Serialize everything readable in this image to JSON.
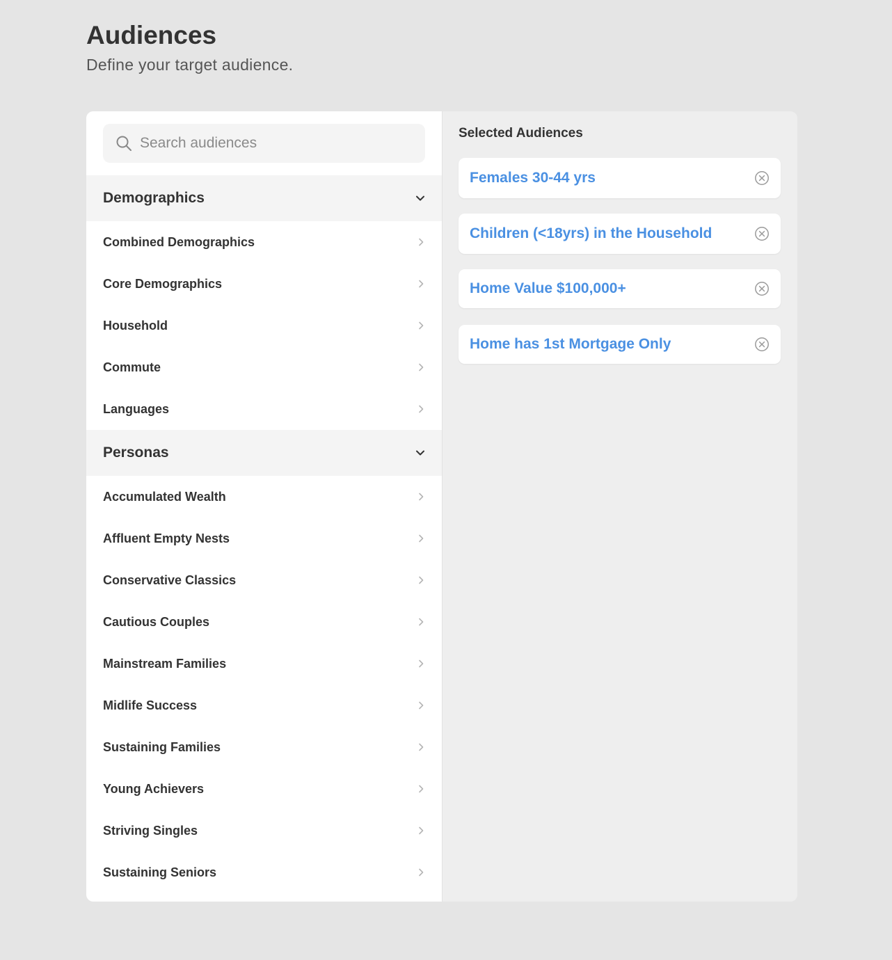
{
  "header": {
    "title": "Audiences",
    "subtitle": "Define your target audience."
  },
  "search": {
    "placeholder": "Search audiences",
    "value": ""
  },
  "groups": [
    {
      "title": "Demographics",
      "expanded": true,
      "items": [
        "Combined Demographics",
        "Core Demographics",
        "Household",
        "Commute",
        "Languages"
      ]
    },
    {
      "title": "Personas",
      "expanded": true,
      "items": [
        "Accumulated Wealth",
        "Affluent Empty Nests",
        "Conservative Classics",
        "Cautious Couples",
        "Mainstream Families",
        "Midlife Success",
        "Sustaining Families",
        "Young Achievers",
        "Striving Singles",
        "Sustaining Seniors"
      ]
    }
  ],
  "selected": {
    "title": "Selected Audiences",
    "items": [
      "Females 30-44 yrs",
      "Children (<18yrs) in the Household",
      "Home Value $100,000+",
      "Home has 1st Mortgage Only"
    ]
  },
  "colors": {
    "accent": "#4a90e2",
    "text": "#333333",
    "page_bg": "#e5e5e5"
  },
  "icons": {
    "search": "search-icon",
    "expand": "chevron-down-icon",
    "open": "chevron-right-icon",
    "remove": "close-circle-icon"
  }
}
